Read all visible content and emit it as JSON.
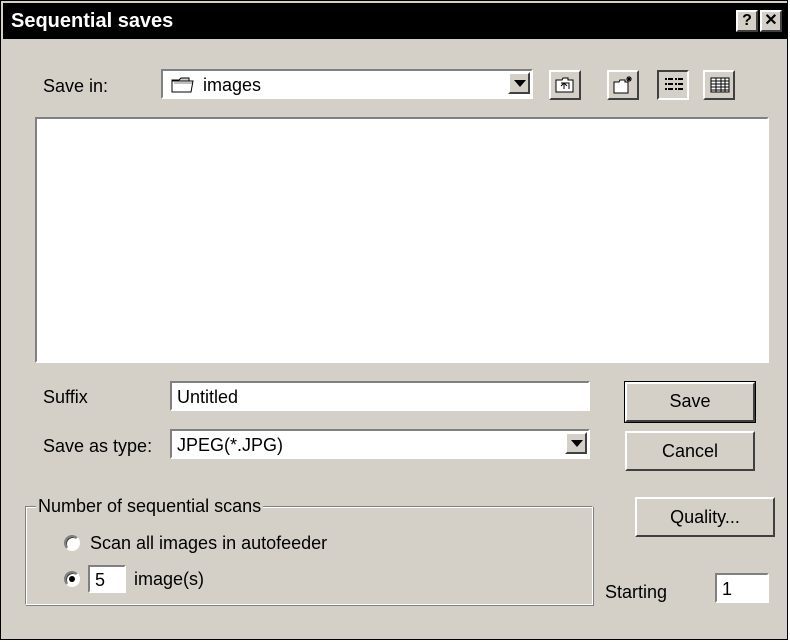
{
  "window": {
    "title": "Sequential saves",
    "help_label": "?",
    "close_label": "✕"
  },
  "save_in": {
    "label": "Save in:",
    "label_underline_char": "i",
    "value": "images",
    "icons": [
      "up-one-level-icon",
      "create-new-folder-icon",
      "list-view-icon",
      "details-view-icon"
    ]
  },
  "file_list": {
    "items": []
  },
  "suffix": {
    "label": "Suffix",
    "value": "Untitled"
  },
  "save_as_type": {
    "label": "Save as type:",
    "value": "JPEG(*.JPG)"
  },
  "buttons": {
    "save": "Save",
    "cancel": "Cancel",
    "quality": "Quality..."
  },
  "sequential_scans": {
    "legend": "Number of sequential scans",
    "option_all": "Scan all images in autofeeder",
    "option_count_suffix": "image(s)",
    "count_value": "5",
    "selected": "count"
  },
  "starting": {
    "label": "Starting",
    "value": "1"
  },
  "colors": {
    "dialog_face": "#d4d0c8",
    "titlebar": "#000000",
    "title_text": "#ffffff"
  }
}
